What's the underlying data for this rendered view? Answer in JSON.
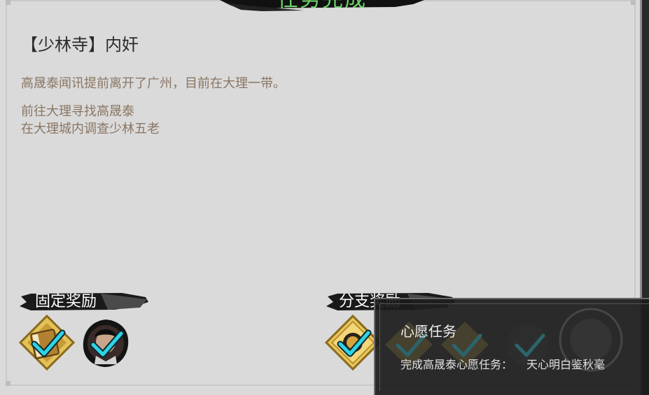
{
  "header": {
    "title": "任务完成"
  },
  "quest": {
    "name": "【少林寺】内奸",
    "description": "高晟泰闻讯提前离开了广州，目前在大理一带。",
    "objectives": [
      "前往大理寻找高晟泰",
      "在大理城内调查少林五老"
    ]
  },
  "rewards": {
    "fixed_label": "固定奖励",
    "branch_label": "分支奖励",
    "fixed_items": [
      {
        "icon": "manual-book-icon",
        "claimed": true
      },
      {
        "icon": "character-portrait-icon",
        "claimed": true
      }
    ],
    "branch_items": [
      {
        "icon": "gold-diamond-icon",
        "claimed": true
      },
      {
        "icon": "gold-diamond-icon",
        "claimed": true
      },
      {
        "icon": "gold-diamond-icon",
        "claimed": true
      },
      {
        "icon": "character-portrait-icon",
        "claimed": true
      }
    ]
  },
  "tooltip": {
    "title": "心愿任务",
    "label": "完成高晟泰心愿任务：",
    "value": "天心明白鉴秋毫"
  },
  "colors": {
    "title_green": "#6ed36a",
    "check_cyan": "#2fd3e6",
    "gold": "#d9b24a",
    "panel_bg": "#dadada",
    "text_brown": "#8a7563"
  }
}
